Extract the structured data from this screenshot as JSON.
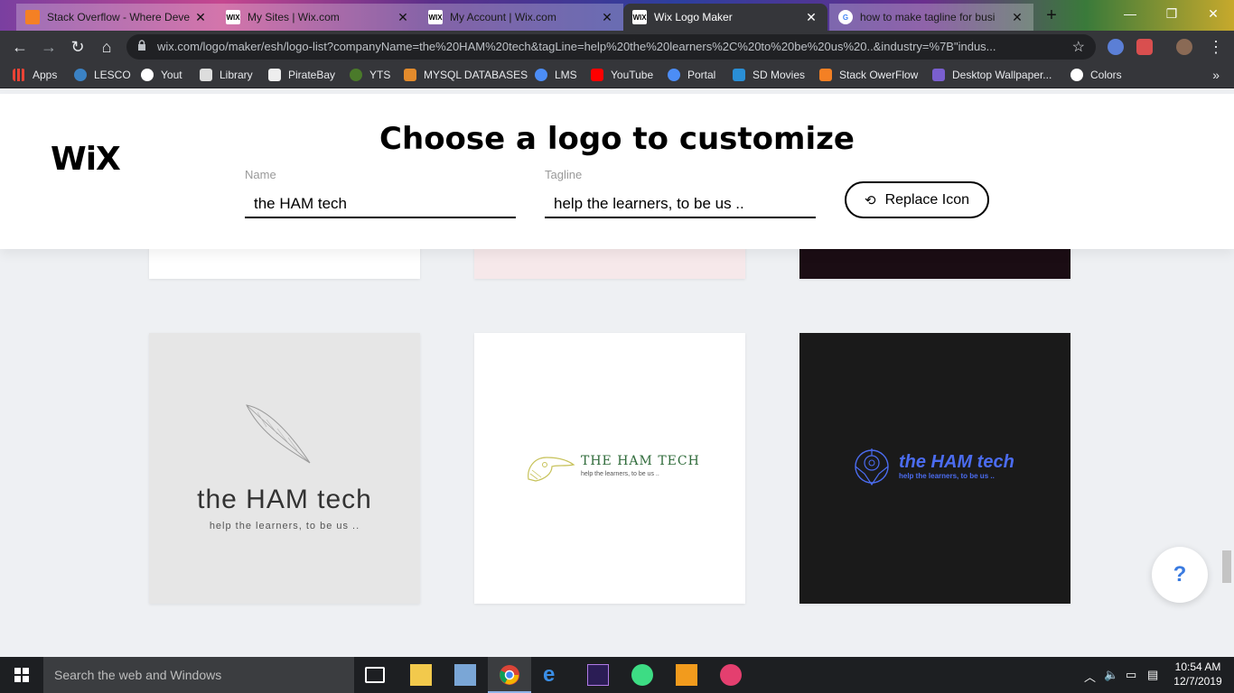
{
  "browser": {
    "tabs": [
      {
        "title": "Stack Overflow - Where Deve",
        "favicon": "stackoverflow-icon",
        "active": false
      },
      {
        "title": "My Sites | Wix.com",
        "favicon": "wix-icon",
        "active": false
      },
      {
        "title": "My Account | Wix.com",
        "favicon": "wix-icon",
        "active": false
      },
      {
        "title": "Wix Logo Maker",
        "favicon": "wix-icon",
        "active": true
      },
      {
        "title": "how to make tagline for busi",
        "favicon": "google-icon",
        "active": false
      }
    ],
    "url": "wix.com/logo/maker/esh/logo-list?companyName=the%20HAM%20tech&tagLine=help%20the%20learners%2C%20to%20be%20us%20..&industry=%7B\"indus...",
    "bookmarks": [
      {
        "label": "Apps"
      },
      {
        "label": "LESCO"
      },
      {
        "label": "Yout"
      },
      {
        "label": "Library"
      },
      {
        "label": "PirateBay"
      },
      {
        "label": "YTS"
      },
      {
        "label": "MYSQL DATABASES"
      },
      {
        "label": "LMS"
      },
      {
        "label": "YouTube"
      },
      {
        "label": "Portal"
      },
      {
        "label": "SD Movies"
      },
      {
        "label": "Stack OwerFlow"
      },
      {
        "label": "Desktop Wallpaper..."
      },
      {
        "label": "Colors"
      }
    ],
    "bookmarks_more": "»"
  },
  "header": {
    "brand": "WiX",
    "headline": "Choose a logo to customize",
    "name_label": "Name",
    "name_value": "the HAM tech",
    "tagline_label": "Tagline",
    "tagline_value": "help the learners, to be us ..",
    "replace_button": "Replace Icon"
  },
  "logos": [
    {
      "name": "the HAM tech",
      "tagline": "help the learners, to be us ..",
      "icon": "quill-feather-icon",
      "background": "#e6e6e6"
    },
    {
      "name": "THE HAM TECH",
      "tagline": "help the learners, to be us ..",
      "icon": "toucan-bird-icon",
      "background": "#ffffff"
    },
    {
      "name": "the HAM tech",
      "tagline": "help the learners, to be us ..",
      "icon": "tribal-emblem-icon",
      "background": "#1a1a1a"
    }
  ],
  "help_button": "?",
  "taskbar": {
    "search_placeholder": "Search the web and Windows",
    "time": "10:54 AM",
    "date": "12/7/2019"
  }
}
